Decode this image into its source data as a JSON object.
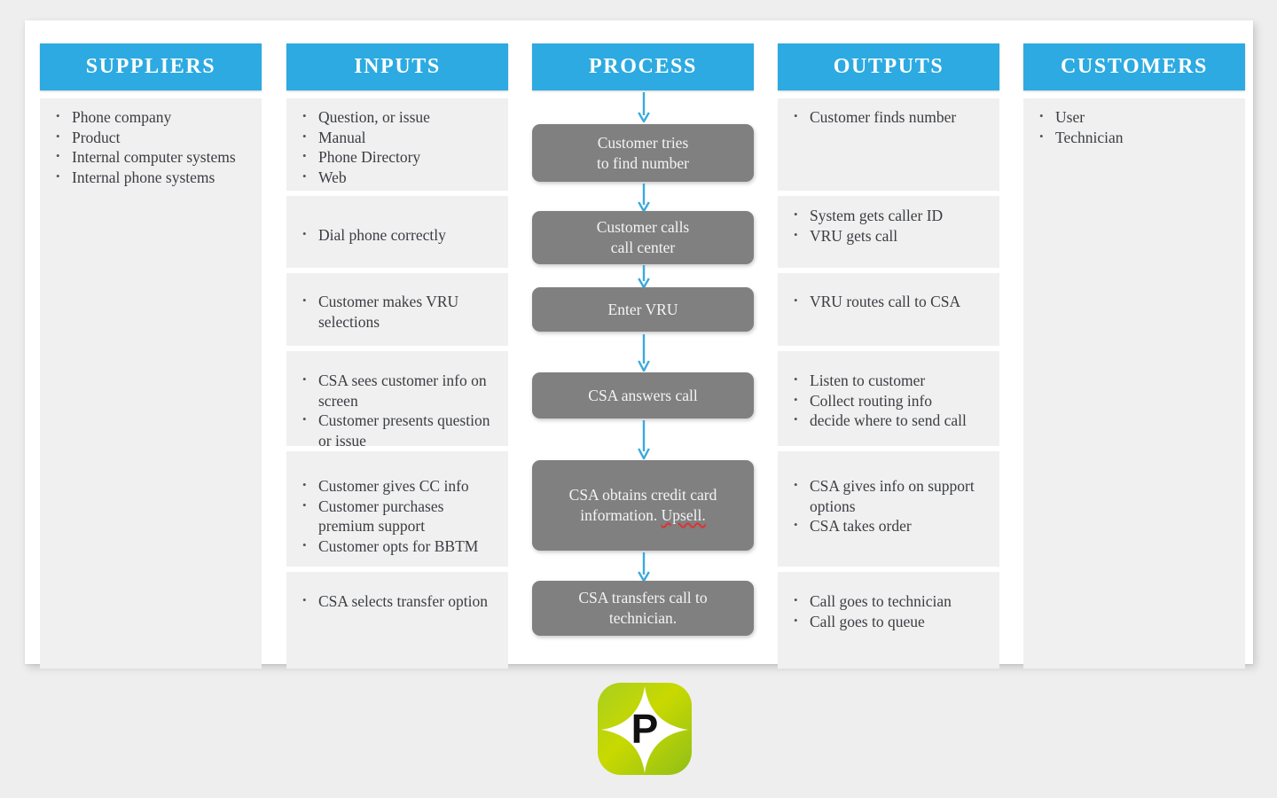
{
  "diagram": {
    "type": "SIPOC",
    "accent_color": "#2daae1",
    "process_box_color": "#808080",
    "cell_color": "#f0f0f0",
    "canvas_color": "#ffffff",
    "background_color": "#eeeeee"
  },
  "columns": [
    {
      "key": "suppliers",
      "header": "SUPPLIERS",
      "cells": [
        {
          "items": [
            "Phone company",
            "Product",
            "Internal computer systems",
            "Internal phone systems"
          ]
        }
      ]
    },
    {
      "key": "inputs",
      "header": "INPUTS",
      "cells": [
        {
          "items": [
            "Question, or issue",
            "Manual",
            "Phone Directory",
            "Web"
          ]
        },
        {
          "items": [
            "Dial phone correctly"
          ]
        },
        {
          "items": [
            "Customer makes VRU selections"
          ]
        },
        {
          "items": [
            "CSA sees customer info on screen",
            "Customer presents question or issue"
          ]
        },
        {
          "items": [
            "Customer gives CC info",
            "Customer purchases premium support",
            "Customer opts for BBTM"
          ]
        },
        {
          "items": [
            "CSA selects transfer option"
          ]
        }
      ]
    },
    {
      "key": "process",
      "header": "PROCESS",
      "steps": [
        {
          "text": "Customer tries\nto find number"
        },
        {
          "text": "Customer calls\ncall center"
        },
        {
          "text": "Enter VRU"
        },
        {
          "text": "CSA answers call"
        },
        {
          "text": "CSA obtains credit card information. ",
          "misspelled_suffix": "Upsell."
        },
        {
          "text": "CSA transfers call to\ntechnician."
        }
      ]
    },
    {
      "key": "outputs",
      "header": "OUTPUTS",
      "cells": [
        {
          "items": [
            "Customer finds number"
          ]
        },
        {
          "items": [
            "System gets caller ID",
            "VRU gets call"
          ]
        },
        {
          "items": [
            "VRU routes call to CSA"
          ]
        },
        {
          "items": [
            "Listen to customer",
            "Collect routing info",
            "decide where to send call"
          ]
        },
        {
          "items": [
            "CSA gives info on support options",
            "CSA takes order"
          ]
        },
        {
          "items": [
            "Call goes to technician",
            "Call goes to queue"
          ]
        }
      ]
    },
    {
      "key": "customers",
      "header": "CUSTOMERS",
      "cells": [
        {
          "items": [
            "User",
            "Technician"
          ]
        }
      ]
    }
  ],
  "logo": {
    "name": "sparkle-p-logo",
    "letter": "P",
    "color_outer": "#9ac81e",
    "color_inner": "#c6d600"
  }
}
